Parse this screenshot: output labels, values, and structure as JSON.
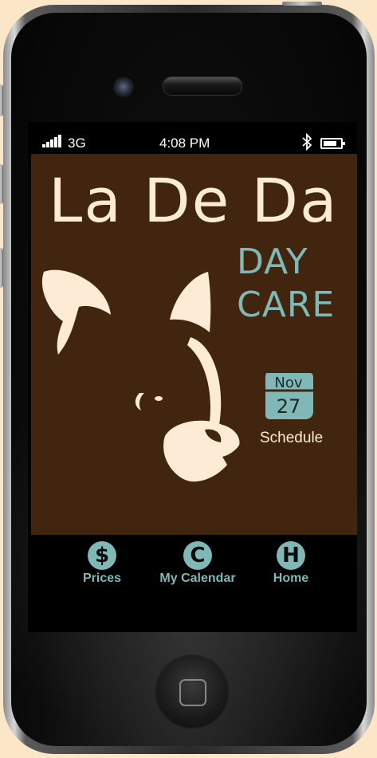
{
  "status_bar": {
    "network": "3G",
    "time": "4:08 PM"
  },
  "app": {
    "title": "La De Da",
    "subtitle_line1": "DAY",
    "subtitle_line2": "CARE",
    "calendar_month": "Nov",
    "calendar_day": "27",
    "schedule_label": "Schedule"
  },
  "tabs": [
    {
      "glyph": "$",
      "label": "Prices"
    },
    {
      "glyph": "C",
      "label": "My Calendar"
    },
    {
      "glyph": "H",
      "label": "Home"
    }
  ],
  "colors": {
    "background": "#fbe6c7",
    "app_brown": "#42250e",
    "cream": "#fdebd6",
    "teal_accent": "#7fb8b7"
  }
}
